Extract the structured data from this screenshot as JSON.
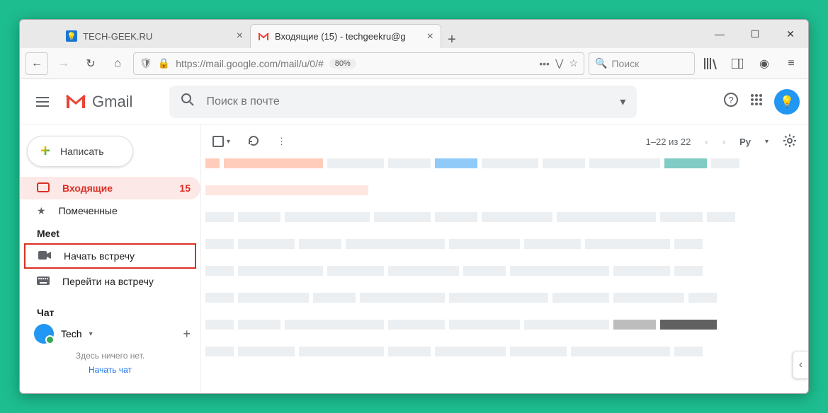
{
  "tabs": [
    {
      "title": "TECH-GEEK.RU"
    },
    {
      "title": "Входящие (15) - techgeekru@g"
    }
  ],
  "toolbar": {
    "url": "https://mail.google.com/mail/u/0/#",
    "zoom": "80%",
    "search_placeholder": "Поиск"
  },
  "gmail": {
    "brand": "Gmail",
    "search_placeholder": "Поиск в почте",
    "compose": "Написать",
    "sidebar": {
      "inbox": {
        "label": "Входящие",
        "count": "15"
      },
      "starred": {
        "label": "Помеченные"
      }
    },
    "meet": {
      "section": "Meet",
      "start": "Начать встречу",
      "join": "Перейти на встречу"
    },
    "chat": {
      "section": "Чат",
      "user": "Tech",
      "empty": "Здесь ничего нет.",
      "start": "Начать чат"
    },
    "pagination": "1–22 из 22",
    "input_badge": "Ру"
  }
}
